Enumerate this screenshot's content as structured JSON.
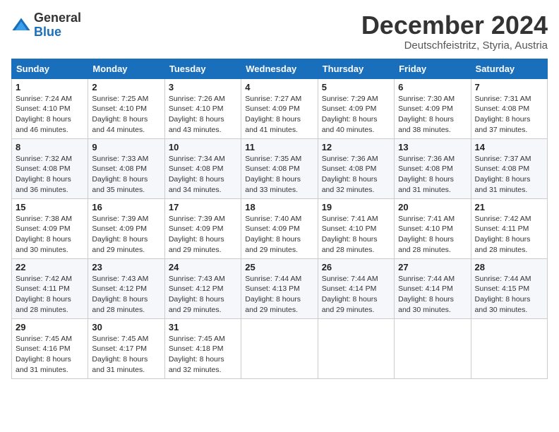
{
  "logo": {
    "general": "General",
    "blue": "Blue"
  },
  "title": "December 2024",
  "subtitle": "Deutschfeistritz, Styria, Austria",
  "days_of_week": [
    "Sunday",
    "Monday",
    "Tuesday",
    "Wednesday",
    "Thursday",
    "Friday",
    "Saturday"
  ],
  "weeks": [
    [
      {
        "day": "1",
        "sunrise": "7:24 AM",
        "sunset": "4:10 PM",
        "daylight": "8 hours and 46 minutes."
      },
      {
        "day": "2",
        "sunrise": "7:25 AM",
        "sunset": "4:10 PM",
        "daylight": "8 hours and 44 minutes."
      },
      {
        "day": "3",
        "sunrise": "7:26 AM",
        "sunset": "4:10 PM",
        "daylight": "8 hours and 43 minutes."
      },
      {
        "day": "4",
        "sunrise": "7:27 AM",
        "sunset": "4:09 PM",
        "daylight": "8 hours and 41 minutes."
      },
      {
        "day": "5",
        "sunrise": "7:29 AM",
        "sunset": "4:09 PM",
        "daylight": "8 hours and 40 minutes."
      },
      {
        "day": "6",
        "sunrise": "7:30 AM",
        "sunset": "4:09 PM",
        "daylight": "8 hours and 38 minutes."
      },
      {
        "day": "7",
        "sunrise": "7:31 AM",
        "sunset": "4:08 PM",
        "daylight": "8 hours and 37 minutes."
      }
    ],
    [
      {
        "day": "8",
        "sunrise": "7:32 AM",
        "sunset": "4:08 PM",
        "daylight": "8 hours and 36 minutes."
      },
      {
        "day": "9",
        "sunrise": "7:33 AM",
        "sunset": "4:08 PM",
        "daylight": "8 hours and 35 minutes."
      },
      {
        "day": "10",
        "sunrise": "7:34 AM",
        "sunset": "4:08 PM",
        "daylight": "8 hours and 34 minutes."
      },
      {
        "day": "11",
        "sunrise": "7:35 AM",
        "sunset": "4:08 PM",
        "daylight": "8 hours and 33 minutes."
      },
      {
        "day": "12",
        "sunrise": "7:36 AM",
        "sunset": "4:08 PM",
        "daylight": "8 hours and 32 minutes."
      },
      {
        "day": "13",
        "sunrise": "7:36 AM",
        "sunset": "4:08 PM",
        "daylight": "8 hours and 31 minutes."
      },
      {
        "day": "14",
        "sunrise": "7:37 AM",
        "sunset": "4:08 PM",
        "daylight": "8 hours and 31 minutes."
      }
    ],
    [
      {
        "day": "15",
        "sunrise": "7:38 AM",
        "sunset": "4:09 PM",
        "daylight": "8 hours and 30 minutes."
      },
      {
        "day": "16",
        "sunrise": "7:39 AM",
        "sunset": "4:09 PM",
        "daylight": "8 hours and 29 minutes."
      },
      {
        "day": "17",
        "sunrise": "7:39 AM",
        "sunset": "4:09 PM",
        "daylight": "8 hours and 29 minutes."
      },
      {
        "day": "18",
        "sunrise": "7:40 AM",
        "sunset": "4:09 PM",
        "daylight": "8 hours and 29 minutes."
      },
      {
        "day": "19",
        "sunrise": "7:41 AM",
        "sunset": "4:10 PM",
        "daylight": "8 hours and 28 minutes."
      },
      {
        "day": "20",
        "sunrise": "7:41 AM",
        "sunset": "4:10 PM",
        "daylight": "8 hours and 28 minutes."
      },
      {
        "day": "21",
        "sunrise": "7:42 AM",
        "sunset": "4:11 PM",
        "daylight": "8 hours and 28 minutes."
      }
    ],
    [
      {
        "day": "22",
        "sunrise": "7:42 AM",
        "sunset": "4:11 PM",
        "daylight": "8 hours and 28 minutes."
      },
      {
        "day": "23",
        "sunrise": "7:43 AM",
        "sunset": "4:12 PM",
        "daylight": "8 hours and 28 minutes."
      },
      {
        "day": "24",
        "sunrise": "7:43 AM",
        "sunset": "4:12 PM",
        "daylight": "8 hours and 29 minutes."
      },
      {
        "day": "25",
        "sunrise": "7:44 AM",
        "sunset": "4:13 PM",
        "daylight": "8 hours and 29 minutes."
      },
      {
        "day": "26",
        "sunrise": "7:44 AM",
        "sunset": "4:14 PM",
        "daylight": "8 hours and 29 minutes."
      },
      {
        "day": "27",
        "sunrise": "7:44 AM",
        "sunset": "4:14 PM",
        "daylight": "8 hours and 30 minutes."
      },
      {
        "day": "28",
        "sunrise": "7:44 AM",
        "sunset": "4:15 PM",
        "daylight": "8 hours and 30 minutes."
      }
    ],
    [
      {
        "day": "29",
        "sunrise": "7:45 AM",
        "sunset": "4:16 PM",
        "daylight": "8 hours and 31 minutes."
      },
      {
        "day": "30",
        "sunrise": "7:45 AM",
        "sunset": "4:17 PM",
        "daylight": "8 hours and 31 minutes."
      },
      {
        "day": "31",
        "sunrise": "7:45 AM",
        "sunset": "4:18 PM",
        "daylight": "8 hours and 32 minutes."
      },
      null,
      null,
      null,
      null
    ]
  ],
  "labels": {
    "sunrise": "Sunrise:",
    "sunset": "Sunset:",
    "daylight": "Daylight:"
  }
}
